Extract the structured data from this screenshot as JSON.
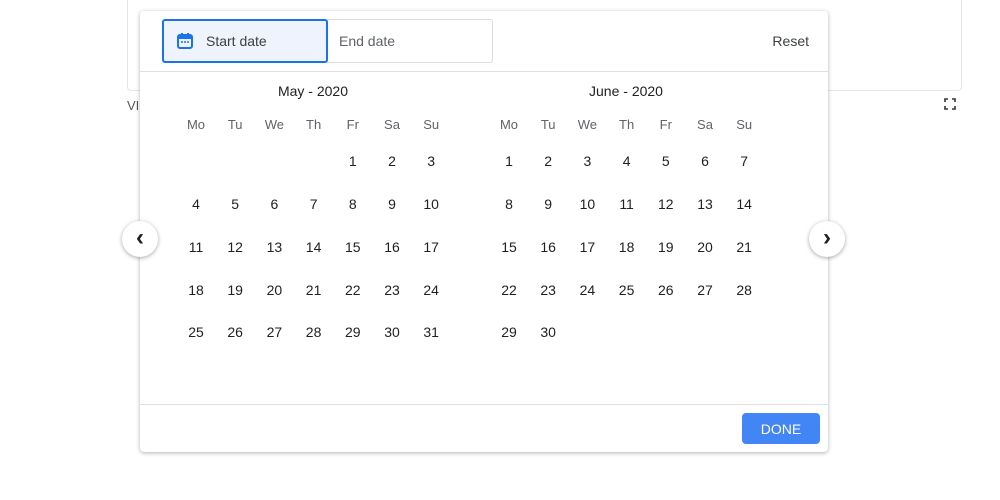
{
  "background": {
    "label": "VI"
  },
  "picker": {
    "start_placeholder": "Start date",
    "end_placeholder": "End date",
    "reset_label": "Reset",
    "done_label": "DONE",
    "weekdays": [
      "Mo",
      "Tu",
      "We",
      "Th",
      "Fr",
      "Sa",
      "Su"
    ],
    "months": [
      {
        "title": "May - 2020",
        "first_weekday_index": 4,
        "days": 31
      },
      {
        "title": "June - 2020",
        "first_weekday_index": 0,
        "days": 30
      }
    ],
    "prev_icon": "‹",
    "next_icon": "›"
  },
  "colors": {
    "accent": "#1a73e8",
    "done_button": "#4285f4"
  }
}
